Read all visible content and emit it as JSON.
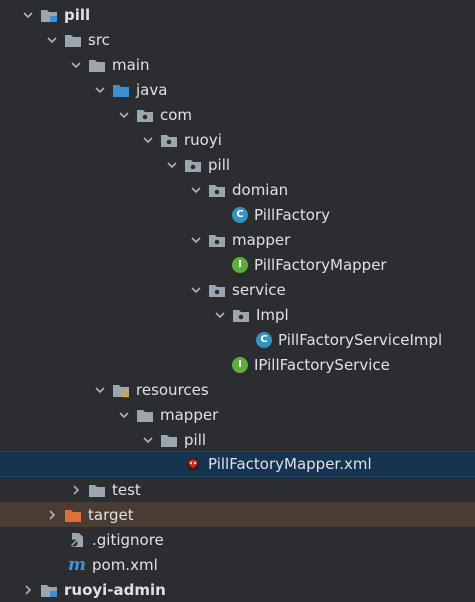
{
  "tree": {
    "items": [
      {
        "label": "pill",
        "icon": "module-folder-icon",
        "expanded": true
      },
      {
        "label": "src",
        "icon": "folder-icon",
        "expanded": true
      },
      {
        "label": "main",
        "icon": "folder-icon",
        "expanded": true
      },
      {
        "label": "java",
        "icon": "source-root-folder-icon",
        "expanded": true
      },
      {
        "label": "com",
        "icon": "package-icon",
        "expanded": true
      },
      {
        "label": "ruoyi",
        "icon": "package-icon",
        "expanded": true
      },
      {
        "label": "pill",
        "icon": "package-icon",
        "expanded": true
      },
      {
        "label": "domian",
        "icon": "package-icon",
        "expanded": true
      },
      {
        "label": "PillFactory",
        "icon": "class-icon"
      },
      {
        "label": "mapper",
        "icon": "package-icon",
        "expanded": true
      },
      {
        "label": "PillFactoryMapper",
        "icon": "interface-icon"
      },
      {
        "label": "service",
        "icon": "package-icon",
        "expanded": true
      },
      {
        "label": "Impl",
        "icon": "package-icon",
        "expanded": true
      },
      {
        "label": "PillFactoryServiceImpl",
        "icon": "class-icon"
      },
      {
        "label": "IPillFactoryService",
        "icon": "interface-icon"
      },
      {
        "label": "resources",
        "icon": "resources-folder-icon",
        "expanded": true
      },
      {
        "label": "mapper",
        "icon": "folder-icon",
        "expanded": true
      },
      {
        "label": "pill",
        "icon": "folder-icon",
        "expanded": true
      },
      {
        "label": "PillFactoryMapper.xml",
        "icon": "mybatis-xml-icon",
        "selected": true
      },
      {
        "label": "test",
        "icon": "folder-icon",
        "expanded": false
      },
      {
        "label": "target",
        "icon": "excluded-folder-icon",
        "expanded": false
      },
      {
        "label": ".gitignore",
        "icon": "gitignore-file-icon"
      },
      {
        "label": "pom.xml",
        "icon": "maven-file-icon"
      },
      {
        "label": "ruoyi-admin",
        "icon": "module-folder-icon",
        "expanded": false
      }
    ]
  },
  "colors": {
    "background": "#2b2d30",
    "selected_row": "#16344f",
    "excluded_row": "#4a3b33",
    "folder": "#9aa7b0",
    "source_root": "#3d8fd4",
    "excluded_folder": "#e0703a",
    "class_badge": "#3592c4",
    "interface_badge": "#5fad3a"
  },
  "icons": {
    "class_letter": "C",
    "interface_letter": "I",
    "maven_letter": "m"
  }
}
